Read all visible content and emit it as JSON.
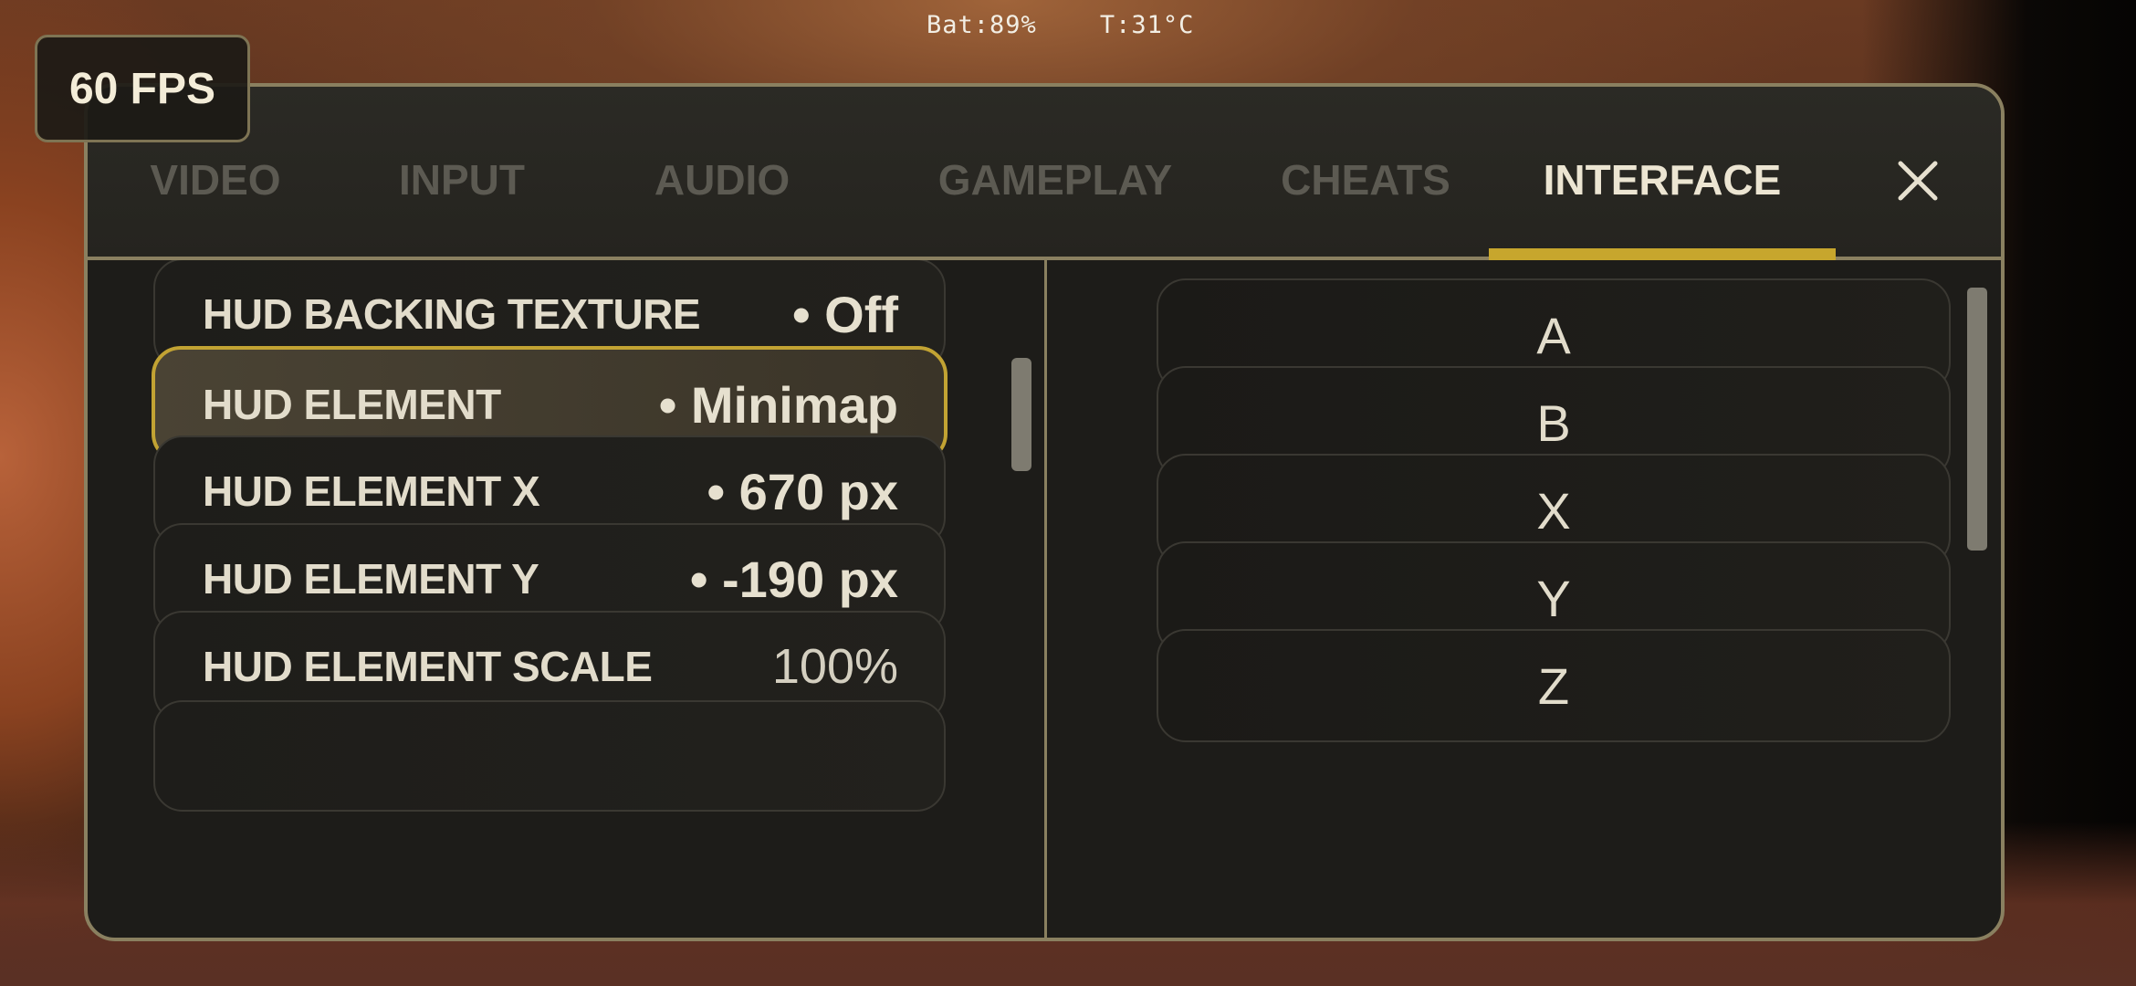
{
  "status": {
    "battery": "Bat:89%",
    "temperature": "T:31°C"
  },
  "fps": "60 FPS",
  "tabs": [
    {
      "label": "VIDEO",
      "active": false
    },
    {
      "label": "INPUT",
      "active": false
    },
    {
      "label": "AUDIO",
      "active": false
    },
    {
      "label": "GAMEPLAY",
      "active": false
    },
    {
      "label": "CHEATS",
      "active": false
    },
    {
      "label": "INTERFACE",
      "active": true
    }
  ],
  "close_icon": "close-icon",
  "settings": [
    {
      "label": "HUD BACKING TEXTURE",
      "value": "• Off"
    },
    {
      "label": "HUD ELEMENT",
      "value": "• Minimap"
    },
    {
      "label": "HUD ELEMENT X",
      "value": "• 670 px"
    },
    {
      "label": "HUD ELEMENT Y",
      "value": "• -190 px"
    },
    {
      "label": "HUD ELEMENT SCALE",
      "value": "100%"
    }
  ],
  "keys": [
    "A",
    "B",
    "X",
    "Y",
    "Z"
  ],
  "colors": {
    "accent": "#c7a62d",
    "frame": "#8a8060",
    "panel": "#1d1c19"
  }
}
